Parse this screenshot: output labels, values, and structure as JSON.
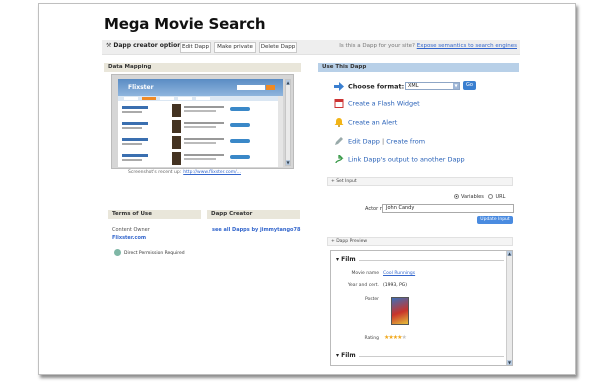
{
  "page": {
    "title": "Mega Movie Search"
  },
  "options_bar": {
    "label": "Dapp creator options:",
    "buttons": [
      "Edit Dapp",
      "Make private",
      "Delete Dapp"
    ],
    "question": "Is this a Dapp for your site?",
    "question_link": "Expose semantics to search engines"
  },
  "left": {
    "data_mapping_header": "Data Mapping",
    "screenshot": {
      "logo": "Flixster"
    },
    "caption": {
      "text": "Screenshot's recent up:",
      "link": "http://www.flixster.com/..."
    },
    "terms_header": "Terms of Use",
    "creator_header": "Dapp Creator",
    "content_owner_label": "Content Owner",
    "content_owner_value": "Flixster.com",
    "creator_link": "see all Dapps by jimmytango78",
    "direct_permission": "Direct Permission Required"
  },
  "right": {
    "header": "Use This Dapp",
    "choose_format_label": "Choose format:",
    "format_value": "XML",
    "go_label": "Go",
    "actions": {
      "flash": "Create a Flash Widget",
      "alert": "Create an Alert",
      "edit": "Edit Dapp",
      "create_from": "Create from",
      "link": "Link Dapp's output to another Dapp"
    },
    "set_input_header": "+ Set Input",
    "radio_variables": "Variables",
    "radio_url": "URL",
    "actor_label": "Actor name",
    "actor_value": "John Candy",
    "update_label": "Update Input",
    "preview_header": "+ Dapp Preview",
    "preview": {
      "film_label": "Film",
      "movie_name_label": "Movie name",
      "movie_name_value": "Cool Runnings",
      "year_label": "Year and cert.",
      "year_value": "(1993, PG)",
      "poster_label": "Poster",
      "rating_label": "Rating",
      "rating_stars": 4,
      "film2_label": "Film"
    }
  },
  "colors": {
    "link": "#2a62b8",
    "panel_header_left": "#e9e6da",
    "panel_header_right": "#b8d0e8",
    "go_button": "#3a7fd0",
    "star": "#f1a81c"
  }
}
